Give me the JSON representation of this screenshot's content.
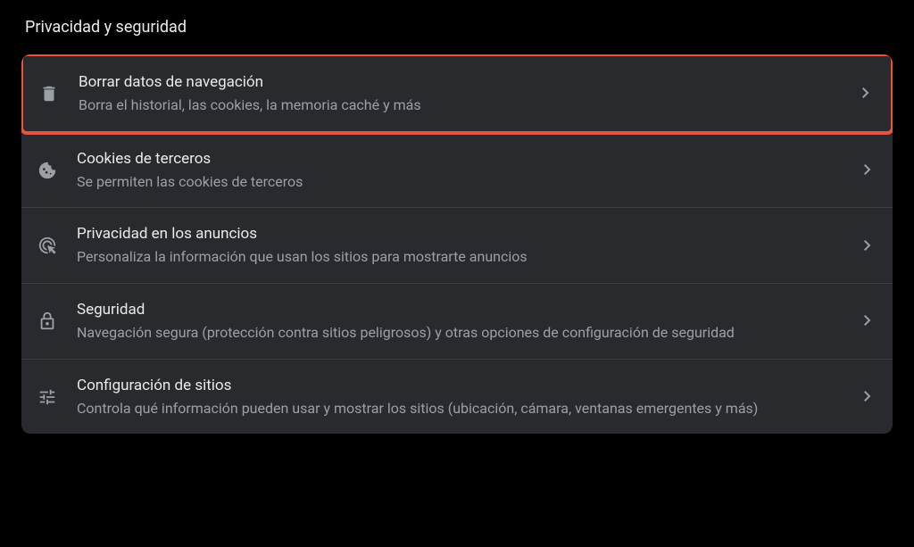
{
  "section": {
    "title": "Privacidad y seguridad"
  },
  "rows": [
    {
      "title": "Borrar datos de navegación",
      "desc": "Borra el historial, las cookies, la memoria caché y más"
    },
    {
      "title": "Cookies de terceros",
      "desc": "Se permiten las cookies de terceros"
    },
    {
      "title": "Privacidad en los anuncios",
      "desc": "Personaliza la información que usan los sitios para mostrarte anuncios"
    },
    {
      "title": "Seguridad",
      "desc": "Navegación segura (protección contra sitios peligrosos) y otras opciones de configuración de seguridad"
    },
    {
      "title": "Configuración de sitios",
      "desc": "Controla qué información pueden usar y mostrar los sitios (ubicación, cámara, ventanas emergentes y más)"
    }
  ]
}
